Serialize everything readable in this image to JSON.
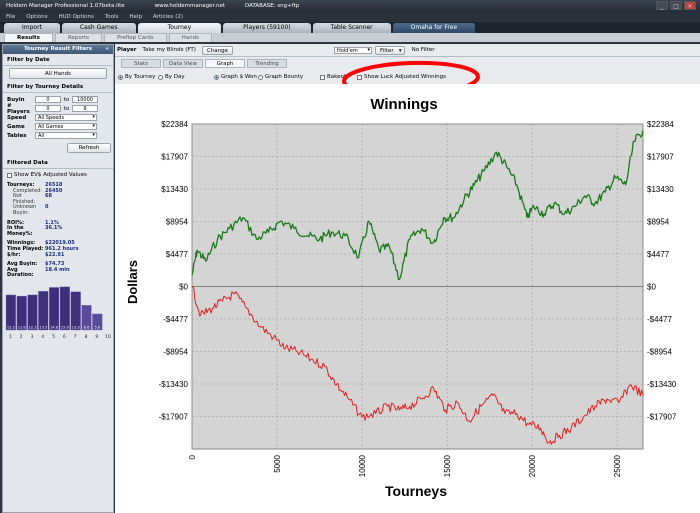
{
  "window": {
    "title": "Holdem Manager Professional 1.07beta.lite",
    "site": "www.holdemmanager.net",
    "database": "DATABASE: sng+ftp",
    "buttons": [
      "_",
      "□",
      "×"
    ]
  },
  "menu": [
    "File",
    "Options",
    "HUD Options",
    "Tools",
    "Help",
    "Articles (2)"
  ],
  "main_tabs": [
    {
      "label": "Import",
      "active": false
    },
    {
      "label": "Cash Games",
      "active": false
    },
    {
      "label": "Tourney",
      "active": true
    },
    {
      "label": "Players (59100)",
      "active": false
    },
    {
      "label": "Table Scanner",
      "active": false
    },
    {
      "label": "Omaha for Free",
      "active": false
    }
  ],
  "sub_tabs": [
    "Results",
    "Reports",
    "Preflop Cards",
    "Hands"
  ],
  "sidebar": {
    "header": "Tourney Result Filters",
    "pin": "«",
    "filter_by_date": "Filter by Date",
    "all_hands": "All Hands",
    "filter_by_details": "Filter by Tourney Details",
    "buyin": {
      "label": "Buyin",
      "from": "0",
      "to_label": "to",
      "to": "10000"
    },
    "players": {
      "label": "# Players",
      "from": "0",
      "to_label": "to",
      "to": "9"
    },
    "speed": {
      "label": "Speed",
      "value": "All Speeds"
    },
    "game": {
      "label": "Game",
      "value": "All Games"
    },
    "tables": {
      "label": "Tables",
      "value": "All"
    },
    "refresh": "Refresh",
    "filtered_data": "Filtered Data",
    "show_ev": "Show EV$ Adjusted Values",
    "stats_1": [
      {
        "k": "Tourneys:",
        "v": "26518",
        "indent": false
      },
      {
        "k": "Completed:",
        "v": "26450",
        "indent": true
      },
      {
        "k": "Not Finished:",
        "v": "68",
        "indent": true
      },
      {
        "k": "Unknown Buyin:",
        "v": "0",
        "indent": true
      }
    ],
    "stats_2": [
      {
        "k": "ROI%:",
        "v": "1.1%",
        "indent": false
      },
      {
        "k": "In the Money%:",
        "v": "36.1%",
        "indent": false
      }
    ],
    "stats_3": [
      {
        "k": "Winnings:",
        "v": "$22019.05",
        "indent": false
      },
      {
        "k": "Time Played:",
        "v": "961.2 hours",
        "indent": false
      },
      {
        "k": "$/hr:",
        "v": "$22.91",
        "indent": false
      }
    ],
    "stats_4": [
      {
        "k": "Avg Buyin:",
        "v": "$74.73",
        "indent": false
      },
      {
        "k": "Avg Duration:",
        "v": "18.4 min",
        "indent": false
      }
    ],
    "hist_values": [
      12.2,
      11.8,
      12.2,
      13.5,
      14.8,
      15.0,
      13.3,
      8.6,
      5.6
    ],
    "hist_labels": [
      "12.2",
      "11.8",
      "12.2",
      "13.5",
      "14.8",
      "15.0",
      "13.3",
      "8.6",
      "5.6"
    ],
    "hist_axis": [
      "1",
      "2",
      "3",
      "4",
      "5",
      "6",
      "7",
      "8",
      "9",
      "10"
    ]
  },
  "toolbar": {
    "player_label": "Player",
    "player_value": "Take my Blinds (FT)",
    "change": "Change",
    "game_value": "Hold'em",
    "filter": "Filter",
    "no_filter": "No Filter"
  },
  "graph_tabs": [
    "Stats",
    "Data View",
    "Graph",
    "Trending"
  ],
  "options": {
    "by_tourney": "By Tourney",
    "by_day": "By Day",
    "graph_won": "Graph $ Won",
    "graph_bounty": "Graph Bounty",
    "bakeoff": "Bakeoff",
    "luck_adjusted": "Show Luck Adjusted Winnings"
  },
  "colors": {
    "won_line": "#1a7a1a",
    "luck_line": "#dd2222",
    "highlight": "#ff0000"
  },
  "chart_data": {
    "type": "line",
    "title": "Winnings",
    "xlabel": "Tourneys",
    "ylabel": "Dollars",
    "xlim": [
      0,
      26518
    ],
    "ylim": [
      -22384,
      22384
    ],
    "x_ticks": [
      0,
      5000,
      10000,
      15000,
      20000,
      25000
    ],
    "y_ticks": [
      22384,
      17907,
      13430,
      8954,
      4477,
      0,
      -4477,
      -8954,
      -13430,
      -17907
    ],
    "y_tick_labels": [
      "$22384",
      "$17907",
      "$13430",
      "$8954",
      "$4477",
      "$0",
      "-$4477",
      "-$8954",
      "-$13430",
      "-$17907"
    ],
    "grid": true,
    "series": [
      {
        "name": "",
        "color": "#1a7a1a",
        "x": [
          0,
          300,
          800,
          1500,
          2200,
          3000,
          3800,
          4500,
          5200,
          6000,
          6800,
          7500,
          8200,
          9000,
          9800,
          10400,
          11000,
          11600,
          12200,
          12800,
          13500,
          14200,
          14800,
          15400,
          16000,
          16600,
          17200,
          17900,
          18500,
          19100,
          19700,
          20100,
          20700,
          21300,
          21900,
          22500,
          23100,
          23700,
          24300,
          24900,
          25500,
          26000,
          26518
        ],
        "y": [
          1500,
          5000,
          3500,
          6500,
          8000,
          9500,
          6500,
          7500,
          9000,
          8000,
          7000,
          6500,
          7500,
          7000,
          4000,
          9000,
          5000,
          5500,
          1000,
          6500,
          8000,
          6000,
          9500,
          9500,
          12000,
          14000,
          16000,
          18500,
          16500,
          14000,
          9500,
          11000,
          10000,
          11500,
          10000,
          11000,
          12500,
          11500,
          13000,
          15000,
          14000,
          20000,
          21500
        ]
      },
      {
        "name": "",
        "color": "#dd2222",
        "x": [
          0,
          500,
          1200,
          1800,
          2500,
          3200,
          4000,
          4800,
          5500,
          6200,
          7000,
          7800,
          8500,
          9200,
          10000,
          10800,
          11500,
          12200,
          12800,
          13500,
          14200,
          14900,
          15600,
          16300,
          17000,
          17700,
          18400,
          19100,
          19800,
          20500,
          21000,
          21600,
          22300,
          23000,
          23700,
          24400,
          25100,
          25800,
          26518
        ],
        "y": [
          0,
          -4000,
          -3000,
          -2000,
          -1000,
          -3000,
          -5500,
          -7000,
          -8500,
          -9000,
          -10000,
          -11000,
          -13500,
          -15500,
          -18000,
          -17500,
          -16500,
          -17000,
          -16500,
          -15500,
          -14000,
          -17000,
          -16000,
          -18500,
          -16500,
          -15000,
          -17500,
          -17500,
          -19000,
          -19500,
          -21500,
          -20500,
          -19500,
          -18000,
          -16500,
          -15500,
          -16000,
          -13500,
          -15000
        ]
      }
    ]
  }
}
